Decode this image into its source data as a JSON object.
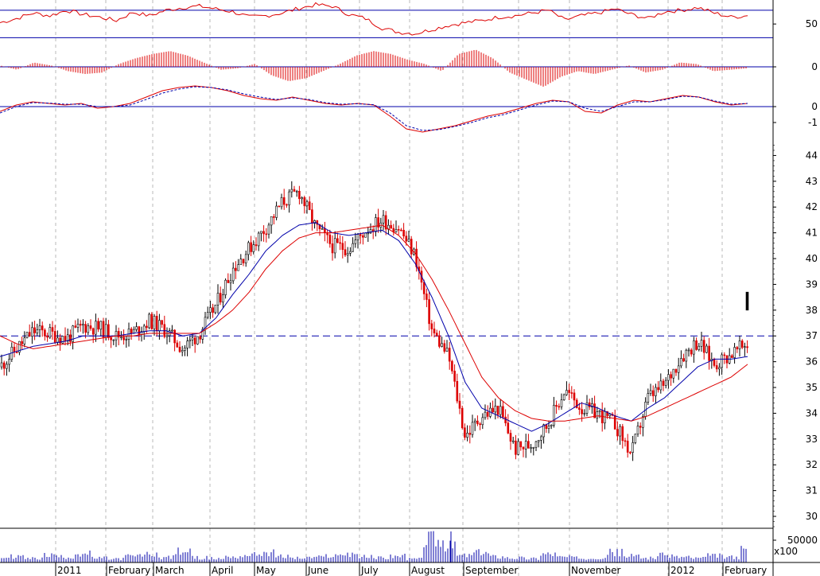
{
  "chart_data": [
    {
      "type": "line",
      "panel": "rsi",
      "y_ticks": [
        "50"
      ],
      "reference_levels": [
        30,
        70
      ],
      "series": [
        {
          "values": [
            52,
            58,
            66,
            62,
            70,
            64,
            60,
            55,
            67,
            62,
            70,
            74,
            76,
            72,
            68,
            60,
            62,
            66,
            73,
            78,
            76,
            64,
            58,
            44,
            38,
            36,
            42,
            48,
            52,
            55,
            60,
            62,
            66,
            70,
            56,
            62,
            66,
            72,
            64,
            58,
            68,
            70,
            74,
            66,
            60,
            62
          ]
        }
      ]
    },
    {
      "type": "bar",
      "panel": "oscillator-histogram",
      "y_ticks": [
        "0"
      ],
      "series": [
        {
          "values": [
            0.1,
            -0.2,
            0.3,
            0.1,
            -0.3,
            -0.5,
            -0.4,
            0.2,
            0.6,
            0.9,
            1.1,
            0.8,
            0.3,
            -0.2,
            -0.1,
            0.2,
            -0.6,
            -1.0,
            -0.8,
            -0.3,
            0.2,
            0.8,
            1.1,
            0.9,
            0.5,
            0.2,
            -0.3,
            0.9,
            1.2,
            0.6,
            -0.4,
            -0.9,
            -1.4,
            -0.7,
            -0.3,
            -0.5,
            -0.2,
            0.1,
            -0.4,
            -0.2,
            0.3,
            0.2,
            -0.3,
            -0.2,
            -0.1
          ]
        }
      ]
    },
    {
      "type": "line",
      "panel": "macd",
      "y_ticks": [
        "0",
        "-1"
      ],
      "series": [
        {
          "values": [
            -0.3,
            0.1,
            0.3,
            0.2,
            0.1,
            0.2,
            -0.1,
            0.0,
            0.2,
            0.6,
            1.0,
            1.2,
            1.3,
            1.2,
            1.0,
            0.7,
            0.5,
            0.4,
            0.6,
            0.4,
            0.2,
            0.1,
            0.2,
            0.1,
            -0.6,
            -1.4,
            -1.6,
            -1.4,
            -1.2,
            -0.9,
            -0.6,
            -0.4,
            -0.1,
            0.2,
            0.4,
            0.3,
            -0.3,
            -0.4,
            0.1,
            0.4,
            0.3,
            0.5,
            0.7,
            0.6,
            0.3,
            0.1,
            0.2
          ]
        },
        {
          "values": [
            -0.4,
            0.0,
            0.25,
            0.22,
            0.15,
            0.15,
            0.0,
            0.0,
            0.1,
            0.45,
            0.85,
            1.1,
            1.25,
            1.2,
            1.05,
            0.8,
            0.6,
            0.45,
            0.55,
            0.45,
            0.25,
            0.15,
            0.18,
            0.12,
            -0.4,
            -1.2,
            -1.5,
            -1.45,
            -1.25,
            -1.0,
            -0.7,
            -0.5,
            -0.2,
            0.1,
            0.35,
            0.3,
            -0.1,
            -0.3,
            0.0,
            0.3,
            0.3,
            0.45,
            0.65,
            0.6,
            0.35,
            0.15,
            0.2
          ]
        }
      ]
    },
    {
      "type": "candlestick",
      "panel": "price",
      "y_ticks": [
        "44",
        "43",
        "42",
        "41",
        "40",
        "39",
        "38",
        "37",
        "36",
        "35",
        "34",
        "33",
        "32",
        "31",
        "30"
      ],
      "ylim": [
        29.6,
        44.6
      ],
      "reference_level": 37,
      "x": [
        "2011",
        "February",
        "March",
        "April",
        "May",
        "June",
        "July",
        "August",
        "September",
        "November",
        "2012",
        "February"
      ],
      "close": [
        35.8,
        36.5,
        37.2,
        37.1,
        36.9,
        37.4,
        37.3,
        37.0,
        37.1,
        37.6,
        37.2,
        36.5,
        37.1,
        38.2,
        39.6,
        40.4,
        41.2,
        42.2,
        42.6,
        41.2,
        40.5,
        40.4,
        41.1,
        41.5,
        41.2,
        40.1,
        37.2,
        36.2,
        33.1,
        33.9,
        34.2,
        32.6,
        32.8,
        33.6,
        34.9,
        34.2,
        34.0,
        33.6,
        32.4,
        34.6,
        35.1,
        36.2,
        36.8,
        35.9,
        36.3,
        36.7
      ],
      "ma_short": [
        36.2,
        36.4,
        36.6,
        36.7,
        36.8,
        37.0,
        37.0,
        37.0,
        37.1,
        37.2,
        37.2,
        37.0,
        37.1,
        37.7,
        38.6,
        39.4,
        40.3,
        40.9,
        41.3,
        41.4,
        41.0,
        40.9,
        41.0,
        41.1,
        40.7,
        39.8,
        38.5,
        37.0,
        35.2,
        34.2,
        33.9,
        33.6,
        33.3,
        33.6,
        34.0,
        34.4,
        34.2,
        33.9,
        33.7,
        34.2,
        34.6,
        35.2,
        35.8,
        36.1,
        36.1,
        36.2
      ],
      "ma_long": [
        37.0,
        36.7,
        36.5,
        36.6,
        36.7,
        36.8,
        36.9,
        37.0,
        37.0,
        37.1,
        37.1,
        37.1,
        37.1,
        37.5,
        38.0,
        38.7,
        39.6,
        40.3,
        40.8,
        41.0,
        41.0,
        41.1,
        41.2,
        41.3,
        40.9,
        40.2,
        39.2,
        38.0,
        36.7,
        35.4,
        34.6,
        34.1,
        33.8,
        33.7,
        33.7,
        33.8,
        33.9,
        33.8,
        33.7,
        33.9,
        34.2,
        34.5,
        34.8,
        35.1,
        35.4,
        35.9
      ],
      "last_high": 38.7,
      "last_low": 38.0
    },
    {
      "type": "bar",
      "panel": "volume",
      "y_ticks": [
        "50000"
      ],
      "scale_label": "x100",
      "values": [
        12,
        15,
        10,
        18,
        14,
        22,
        11,
        9,
        16,
        20,
        13,
        28,
        12,
        10,
        14,
        19,
        24,
        15,
        11,
        13,
        17,
        22,
        14,
        12,
        16,
        9,
        60,
        40,
        18,
        24,
        15,
        12,
        10,
        22,
        14,
        11,
        13,
        25,
        16,
        12,
        18,
        14,
        11,
        17,
        13,
        30
      ]
    }
  ]
}
